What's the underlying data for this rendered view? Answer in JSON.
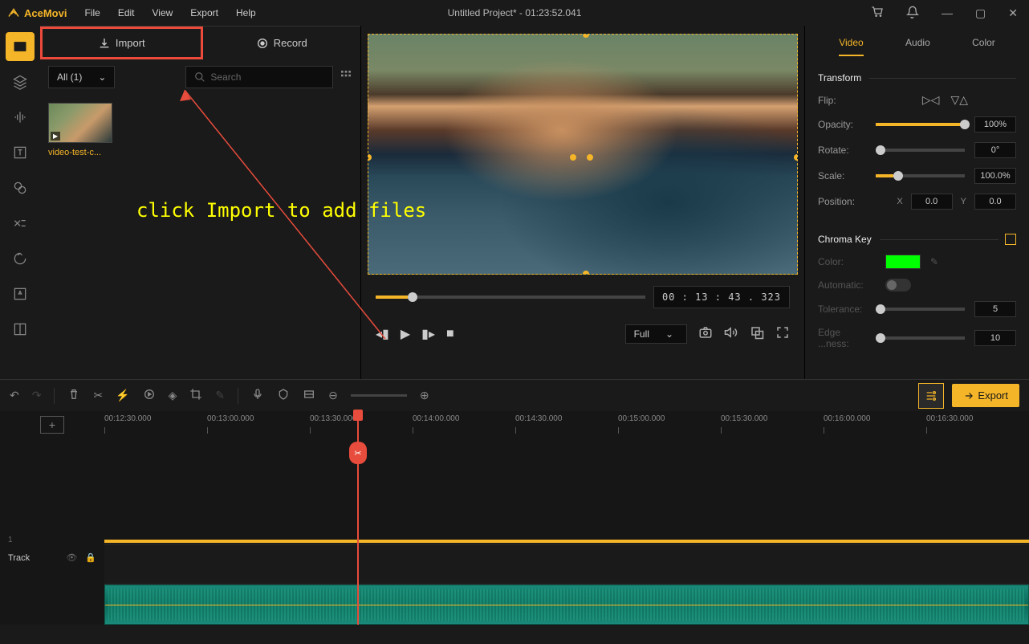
{
  "app": {
    "name": "AceMovi",
    "title": "Untitled Project* - 01:23:52.041"
  },
  "menu": [
    "File",
    "Edit",
    "View",
    "Export",
    "Help"
  ],
  "media": {
    "import_label": "Import",
    "record_label": "Record",
    "filter": "All (1)",
    "search_placeholder": "Search",
    "thumb_name": "video-test-c..."
  },
  "annotation": "click Import to add files",
  "playback": {
    "timecode": "00 : 13 : 43 . 323",
    "fit": "Full"
  },
  "props": {
    "tabs": [
      "Video",
      "Audio",
      "Color"
    ],
    "transform": "Transform",
    "flip": "Flip:",
    "opacity": "Opacity:",
    "opacity_val": "100%",
    "rotate": "Rotate:",
    "rotate_val": "0°",
    "scale": "Scale:",
    "scale_val": "100.0%",
    "position": "Position:",
    "pos_x": "0.0",
    "pos_y": "0.0",
    "chroma": "Chroma Key",
    "color": "Color:",
    "automatic": "Automatic:",
    "tolerance": "Tolerance:",
    "tolerance_val": "5",
    "edge": "Edge ...ness:",
    "edge_val": "10"
  },
  "export_label": "Export",
  "timeline": {
    "ticks": [
      "00:12:30.000",
      "00:13:00.000",
      "00:13:30.000",
      "00:14:00.000",
      "00:14:30.000",
      "00:15:00.000",
      "00:15:30.000",
      "00:16:00.000",
      "00:16:30.000"
    ],
    "track_label": "Track",
    "track_num": "1"
  }
}
